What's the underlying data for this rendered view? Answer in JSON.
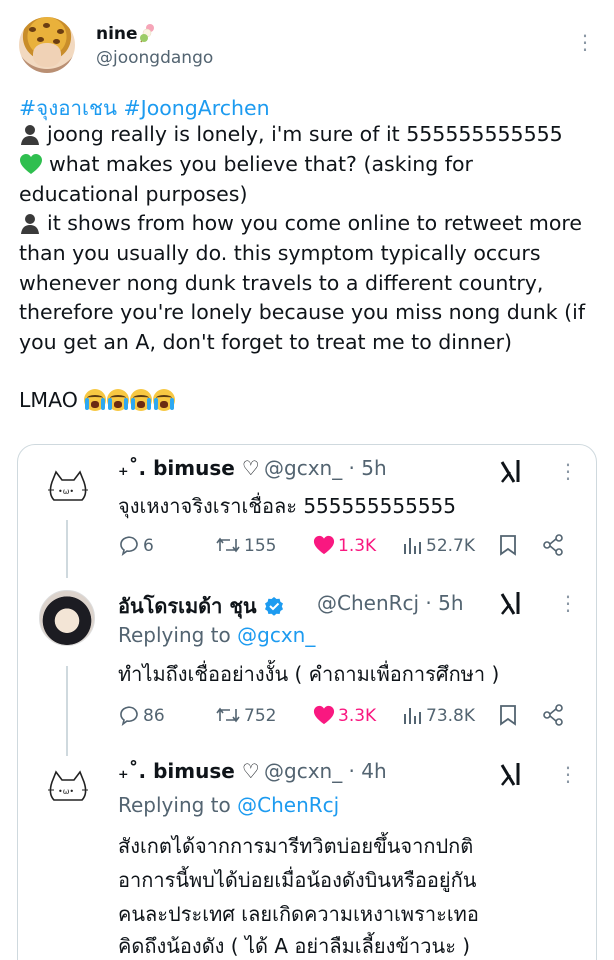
{
  "author": {
    "name": "nine",
    "handle": "@joongdango"
  },
  "tweet": {
    "hashtags": "#จุงอาเชน #JoongArchen",
    "line1": "joong really is lonely, i'm sure of it 555555555555",
    "line2": "what makes you believe that? (asking for",
    "line3": "educational purposes)",
    "line4": "it shows from how you come online to retweet more",
    "line5": "than you usually do. this symptom typically occurs",
    "line6": "whenever nong dunk travels to a different country,",
    "line7": "therefore you're lonely because you miss nong dunk (if",
    "line8": "you get an A, don't forget to treat me to dinner)",
    "line9": "LMAO"
  },
  "replies": [
    {
      "name": "₊˚. bimuse ♡",
      "handle": "@gcxn_ · 5h",
      "text": "จุงเหงาจริงเราเชื่อละ 555555555555",
      "metrics": {
        "replies": "6",
        "retweets": "155",
        "likes": "1.3K",
        "views": "52.7K"
      }
    },
    {
      "name": "อันโดรเมด้า ชุน",
      "handle": "@ChenRcj · 5h",
      "replying_prefix": "Replying to ",
      "replying_to": "@gcxn_",
      "text": "ทำไมถึงเชื่ออย่างงั้น ( คำถามเพื่อการศึกษา )",
      "metrics": {
        "replies": "86",
        "retweets": "752",
        "likes": "3.3K",
        "views": "73.8K"
      }
    },
    {
      "name": "₊˚. bimuse ♡",
      "handle": "@gcxn_ · 4h",
      "replying_prefix": "Replying to ",
      "replying_to": "@ChenRcj",
      "text_lines": [
        "สังเกตได้จากการมารีทวิตบ่อยขึ้นจากปกติ",
        "อาการนี้พบได้บ่อยเมื่อน้องดังบินหรืออยู่กัน",
        "คนละประเทศ เลยเกิดความเหงาเพราะเทอ",
        "คิดถึงน้องดัง ( ได้ A อย่าลืมเลี้ยงข้าวนะ )"
      ]
    }
  ],
  "colors": {
    "accent": "#1d9bf0",
    "like": "#f91880",
    "muted": "#536471",
    "border": "#cfd9de"
  }
}
